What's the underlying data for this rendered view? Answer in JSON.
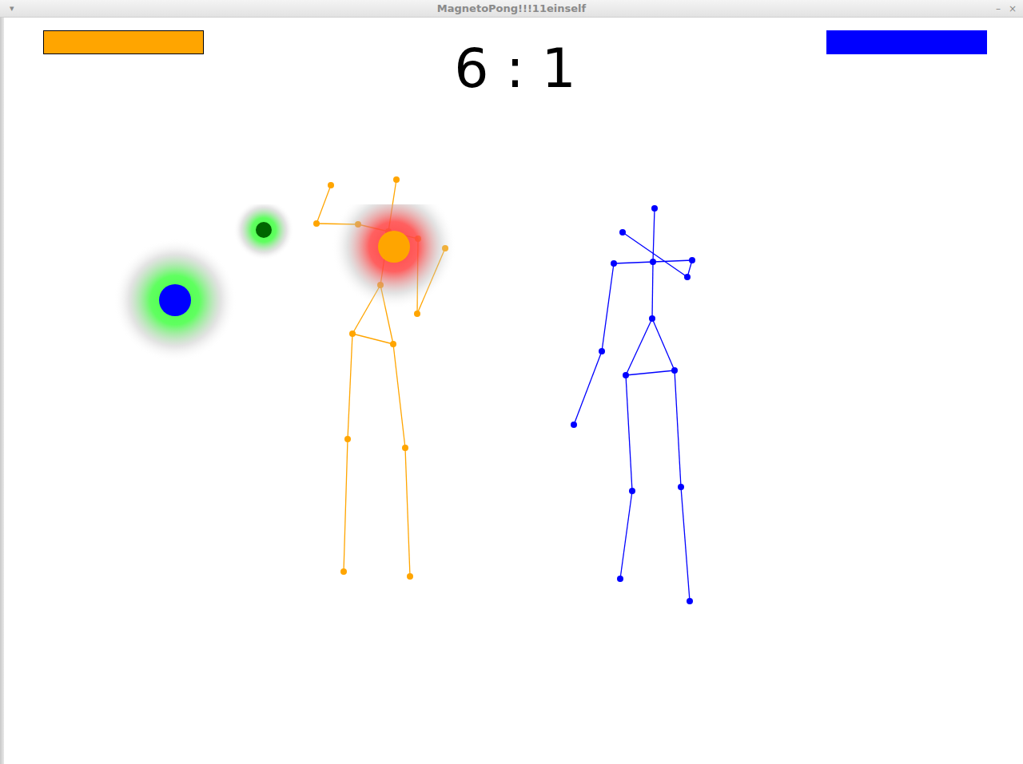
{
  "window": {
    "title": "MagnetoPong!!!11einself",
    "menu_glyph": "▾",
    "controls": [
      "–",
      "×"
    ]
  },
  "score": "6 : 1",
  "players": [
    {
      "color": "#ffa500",
      "level": 1,
      "outlined": true
    },
    {
      "color": "#0000ff",
      "level": 1,
      "outlined": false
    }
  ],
  "balls": [
    {
      "color": "#0000ff",
      "glow": "#44ff44"
    },
    {
      "color": "#006400",
      "glow": "#44ff44"
    },
    {
      "color": "#ffa500",
      "glow": "#ff4444"
    }
  ]
}
